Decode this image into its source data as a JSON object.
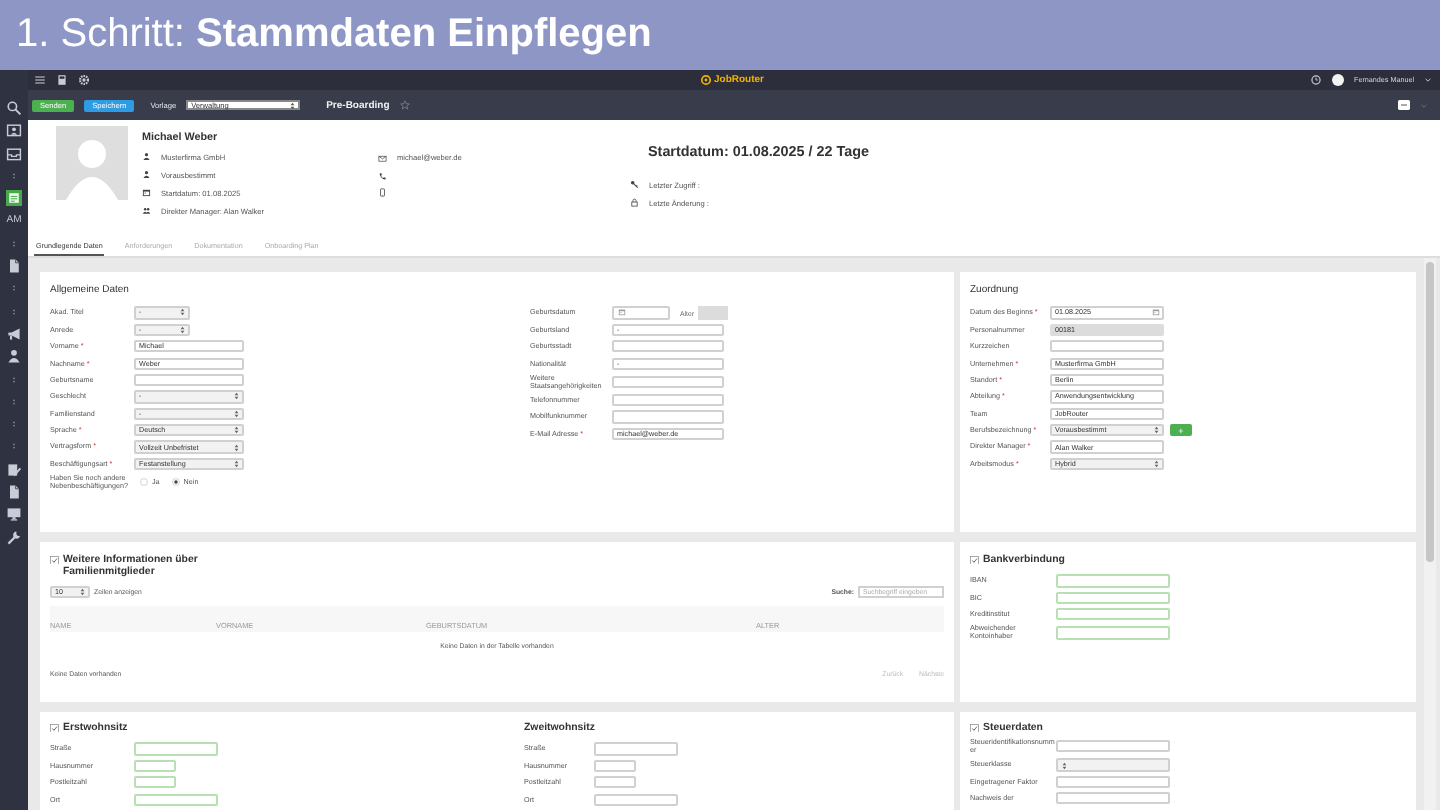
{
  "banner": {
    "title": "1. Schritt: **Stammdaten Einpflegen**"
  },
  "sidebar": {
    "items": [
      {
        "kind": "search",
        "selected": false
      },
      {
        "kind": "card",
        "selected": false
      },
      {
        "kind": "tray",
        "selected": false
      },
      {
        "kind": "dots",
        "selected": false
      },
      {
        "kind": "app",
        "selected": true
      },
      {
        "kind": "text",
        "label": "AM",
        "selected": false
      },
      {
        "kind": "dots",
        "selected": false
      },
      {
        "kind": "doc",
        "selected": false
      },
      {
        "kind": "dots",
        "selected": false
      },
      {
        "kind": "dots",
        "selected": false
      },
      {
        "kind": "megaphone",
        "selected": false
      },
      {
        "kind": "person",
        "selected": false
      },
      {
        "kind": "dots",
        "selected": false
      },
      {
        "kind": "dots",
        "selected": false
      },
      {
        "kind": "dots",
        "selected": false
      },
      {
        "kind": "dots",
        "selected": false
      },
      {
        "kind": "edit",
        "selected": false
      },
      {
        "kind": "doc",
        "selected": false
      },
      {
        "kind": "monitor",
        "selected": false
      },
      {
        "kind": "wrench",
        "selected": false
      }
    ]
  },
  "topbar": {
    "logo": "JobRouter",
    "user": "Fernandes Manuel"
  },
  "toolbar": {
    "buttons": [
      {
        "label": "Senden",
        "kind": "send"
      },
      {
        "label": "Speichern",
        "kind": "save"
      }
    ],
    "template_label": "Vorlage",
    "template_value": "Verwaltung",
    "process": "Pre-Boarding",
    "favorite": false
  },
  "header": {
    "name": "Michael Weber",
    "details": [
      {
        "kind": "person",
        "text": "Musterfirma GmbH"
      },
      {
        "kind": "person",
        "text": "Vorausbestimmt"
      },
      {
        "kind": "calendar",
        "text": "Startdatum: 01.08.2025"
      },
      {
        "kind": "people",
        "text": "Direkter Manager: Alan Walker"
      }
    ],
    "contacts": [
      {
        "kind": "mail",
        "text": "michael@weber.de"
      },
      {
        "kind": "phone"
      },
      {
        "kind": "mobile"
      }
    ],
    "headline": "Startdatum: 01.08.2025 / 22 Tage",
    "meta": [
      {
        "kind": "key",
        "text": "Letzter Zugriff :"
      },
      {
        "kind": "lock",
        "text": "Letzte Änderung :"
      }
    ]
  },
  "tabs": [
    {
      "label": "Grundlegende Daten",
      "selected": true
    },
    {
      "label": "Anforderungen",
      "selected": false
    },
    {
      "label": "Dokumentation",
      "selected": false
    },
    {
      "label": "Onboarding Plan",
      "selected": false
    }
  ],
  "general": {
    "title": "Allgemeine Daten",
    "left": [
      {
        "label": "Akad. Titel",
        "kind": "short-select",
        "value": "-"
      },
      {
        "label": "Anrede",
        "kind": "short-select",
        "value": "-"
      },
      {
        "label": "Vorname",
        "required_mark": "*",
        "kind": "text",
        "value": "Michael"
      },
      {
        "label": "Nachname",
        "required_mark": "*",
        "kind": "text",
        "value": "Weber"
      },
      {
        "label": "Geburtsname",
        "kind": "text"
      },
      {
        "label": "Geschlecht",
        "kind": "select",
        "value": "-"
      },
      {
        "label": "Familienstand",
        "kind": "select",
        "value": "-"
      },
      {
        "label": "Sprache",
        "required_mark": "*",
        "kind": "select",
        "value": "Deutsch"
      },
      {
        "label": "Vertragsform",
        "required_mark": "*",
        "kind": "select",
        "value": "Vollzeit Unbefristet"
      },
      {
        "label": "Beschäftigungsart",
        "required_mark": "*",
        "kind": "select",
        "value": "Festanstellung"
      },
      {
        "label": "Haben Sie noch andere Nebenbeschäftigungen?",
        "kind": "radio",
        "options": [
          {
            "label": "Ja",
            "selected": false
          },
          {
            "label": "Nein",
            "selected": true
          }
        ]
      }
    ],
    "right": [
      {
        "label": "Geburtsdatum",
        "kind": "date",
        "age_label": "Alter"
      },
      {
        "label": "Geburtsland",
        "kind": "text",
        "value": "-"
      },
      {
        "label": "Geburtsstadt",
        "kind": "text"
      },
      {
        "label": "Nationalität",
        "kind": "text",
        "value": "-"
      },
      {
        "label": "Weitere Staatsangehörigkeiten",
        "kind": "text"
      },
      {
        "label": "Telefonnummer",
        "kind": "text"
      },
      {
        "label": "Mobilfunknummer",
        "kind": "text"
      },
      {
        "label": "E-Mail Adresse",
        "required_mark": "*",
        "kind": "text",
        "value": "michael@weber.de"
      }
    ]
  },
  "assignment": {
    "title": "Zuordnung",
    "fields": [
      {
        "label": "Datum des Beginns",
        "required_mark": "*",
        "kind": "date",
        "value": "01.08.2025"
      },
      {
        "label": "Personalnummer",
        "kind": "readonly",
        "value": "00181"
      },
      {
        "label": "Kurzzeichen",
        "kind": "text"
      },
      {
        "label": "Unternehmen",
        "required_mark": "*",
        "kind": "text",
        "value": "Musterfirma GmbH"
      },
      {
        "label": "Standort",
        "required_mark": "*",
        "kind": "text",
        "value": "Berlin"
      },
      {
        "label": "Abteilung",
        "required_mark": "*",
        "kind": "text",
        "value": "Anwendungsentwicklung"
      },
      {
        "label": "Team",
        "kind": "text",
        "value": "JobRouter"
      },
      {
        "label": "Berufsbezeichnung",
        "required_mark": "*",
        "kind": "select",
        "value": "Vorausbestimmt",
        "add_button": "+"
      },
      {
        "label": "Direkter Manager",
        "required_mark": "*",
        "kind": "text",
        "value": "Alan Walker"
      },
      {
        "label": "Arbeitsmodus",
        "required_mark": "*",
        "kind": "select",
        "value": "Hybrid"
      }
    ]
  },
  "family": {
    "checked": true,
    "title": "Weitere Informationen über Familienmitglieder",
    "page_length": "10",
    "page_length_label": "Zeilen anzeigen",
    "search_label": "Suche:",
    "search_placeholder": "Suchbegriff eingeben",
    "columns": [
      "NAME",
      "VORNAME",
      "GEBURTSDATUM",
      "ALTER"
    ],
    "empty": "Keine Daten in der Tabelle vorhanden",
    "info": "Keine Daten vorhanden",
    "pager": [
      {
        "label": "Zurück",
        "disabled": true
      },
      {
        "label": "Nächste",
        "disabled": true
      }
    ]
  },
  "bank": {
    "checked": true,
    "title": "Bankverbindung",
    "fields": [
      {
        "label": "IBAN",
        "kind": "highlight"
      },
      {
        "label": "BIC",
        "kind": "highlight"
      },
      {
        "label": "Kreditinstitut",
        "kind": "highlight"
      },
      {
        "label": "Abweichender Kontoinhaber",
        "kind": "highlight"
      }
    ]
  },
  "addresses": [
    {
      "checked": true,
      "title": "Erstwohnsitz",
      "fields": [
        {
          "label": "Straße",
          "kind": "highlight"
        },
        {
          "label": "Hausnummer",
          "kind": "short-highlight"
        },
        {
          "label": "Postleitzahl",
          "kind": "short-highlight"
        },
        {
          "label": "Ort",
          "kind": "highlight"
        }
      ]
    },
    {
      "title": "Zweitwohnsitz",
      "fields": [
        {
          "label": "Straße",
          "kind": "text"
        },
        {
          "label": "Hausnummer",
          "kind": "short"
        },
        {
          "label": "Postleitzahl",
          "kind": "short"
        },
        {
          "label": "Ort",
          "kind": "text"
        }
      ]
    }
  ],
  "tax": {
    "checked": true,
    "title": "Steuerdaten",
    "fields": [
      {
        "label": "Steueridentifikationsnummer",
        "kind": "text"
      },
      {
        "label": "Steuerklasse",
        "kind": "select"
      },
      {
        "label": "Eingetragener Faktor",
        "kind": "text"
      },
      {
        "label": "Nachweis der",
        "kind": "text"
      }
    ]
  }
}
